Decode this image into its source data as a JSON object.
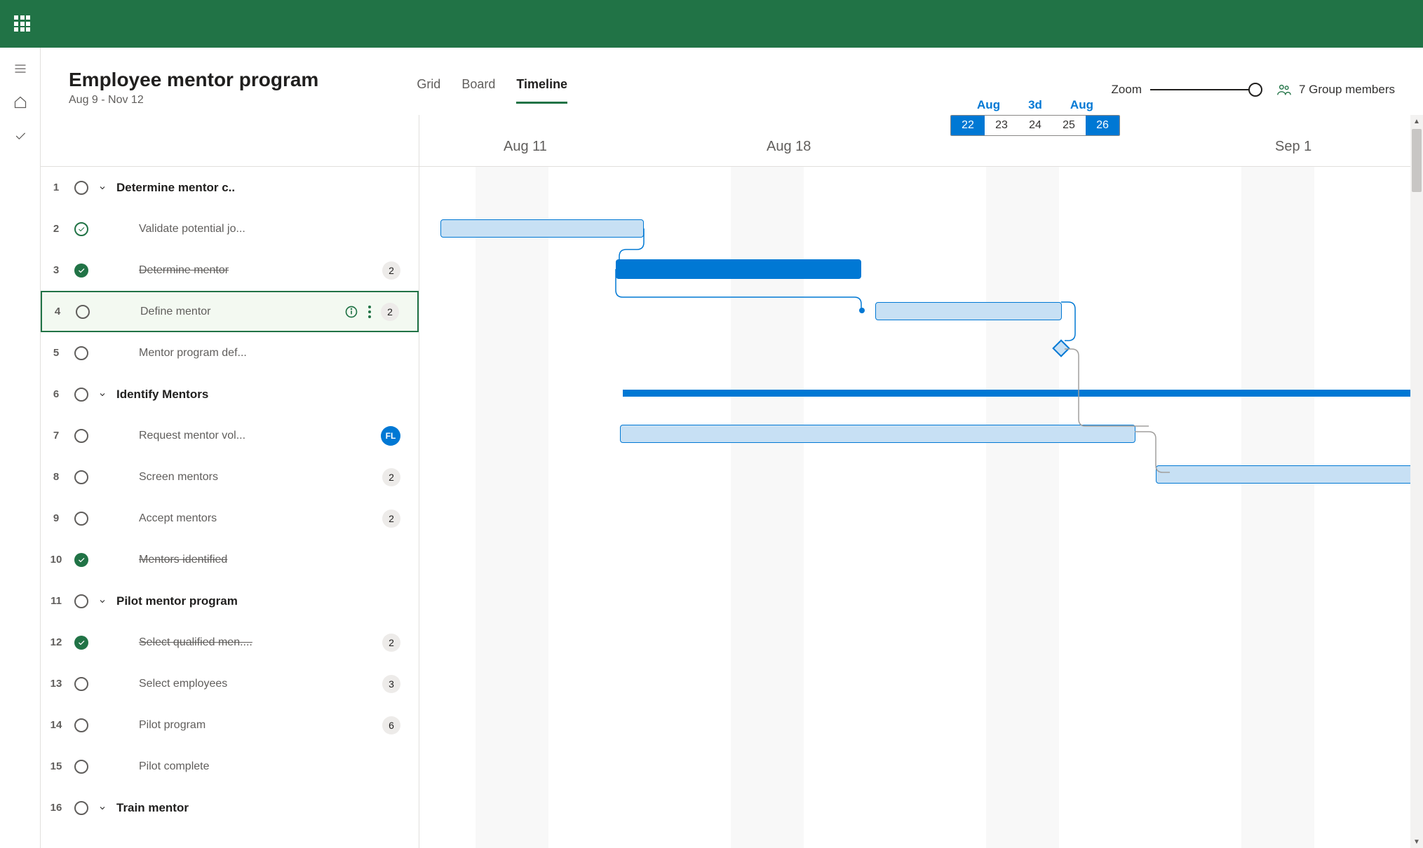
{
  "project": {
    "title": "Employee mentor program",
    "date_range": "Aug 9 - Nov 12"
  },
  "views": {
    "grid": "Grid",
    "board": "Board",
    "timeline": "Timeline",
    "active": "timeline"
  },
  "zoom": {
    "label": "Zoom"
  },
  "members": {
    "label": "7 Group members"
  },
  "date_picker": {
    "month": "Aug",
    "duration": "3d",
    "end_month": "Aug",
    "days": [
      "22",
      "23",
      "24",
      "25",
      "26"
    ],
    "selected": [
      0,
      4
    ]
  },
  "timeline_dates": [
    "Aug 11",
    "Aug 18",
    "Sep  1"
  ],
  "tasks": [
    {
      "num": "1",
      "status": "open",
      "summary": true,
      "name": "Determine mentor c.."
    },
    {
      "num": "2",
      "status": "done-outline",
      "sub": true,
      "name": "Validate potential jo..."
    },
    {
      "num": "3",
      "status": "done-fill",
      "sub": true,
      "strike": true,
      "name": "Determine mentor",
      "badge": "2"
    },
    {
      "num": "4",
      "status": "open",
      "sub": true,
      "name": "Define mentor",
      "info": true,
      "more": true,
      "badge": "2",
      "selected": true
    },
    {
      "num": "5",
      "status": "open",
      "sub": true,
      "name": "Mentor program def..."
    },
    {
      "num": "6",
      "status": "open",
      "summary": true,
      "name": "Identify Mentors"
    },
    {
      "num": "7",
      "status": "open",
      "sub": true,
      "name": "Request mentor vol...",
      "avatar": "FL"
    },
    {
      "num": "8",
      "status": "open",
      "sub": true,
      "name": "Screen mentors",
      "badge": "2"
    },
    {
      "num": "9",
      "status": "open",
      "sub": true,
      "name": "Accept mentors",
      "badge": "2"
    },
    {
      "num": "10",
      "status": "done-fill",
      "sub": true,
      "strike": true,
      "name": "Mentors identified"
    },
    {
      "num": "11",
      "status": "open",
      "summary": true,
      "name": "Pilot mentor  program"
    },
    {
      "num": "12",
      "status": "done-fill",
      "sub": true,
      "strike": true,
      "name": "Select qualified men....",
      "badge": "2"
    },
    {
      "num": "13",
      "status": "open",
      "sub": true,
      "name": "Select employees",
      "badge": "3"
    },
    {
      "num": "14",
      "status": "open",
      "sub": true,
      "name": "Pilot program",
      "badge": "6"
    },
    {
      "num": "15",
      "status": "open",
      "sub": true,
      "name": "Pilot complete"
    },
    {
      "num": "16",
      "status": "open",
      "summary": true,
      "name": "Train mentor"
    }
  ]
}
